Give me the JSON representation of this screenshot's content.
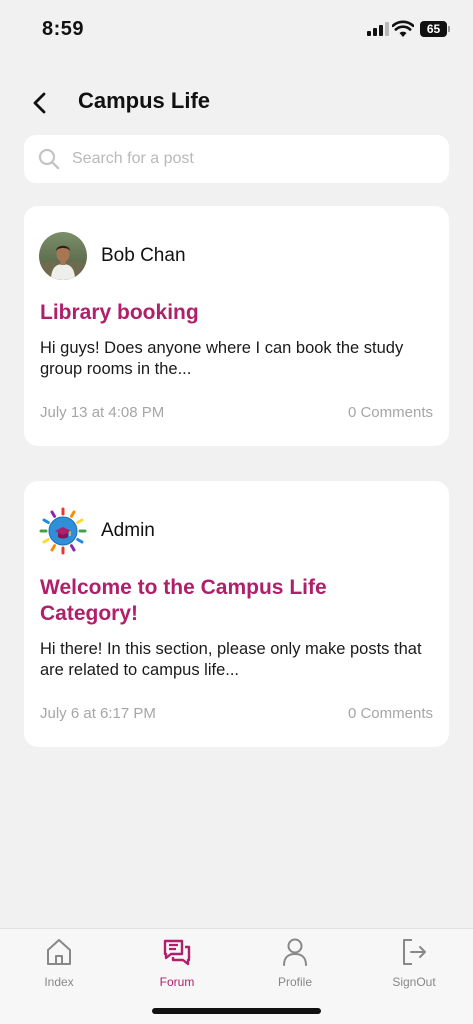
{
  "status_bar": {
    "time": "8:59",
    "battery": "65"
  },
  "header": {
    "title": "Campus Life"
  },
  "search": {
    "placeholder": "Search for a post",
    "value": ""
  },
  "posts": [
    {
      "author": "Bob Chan",
      "avatar_icon": "user-photo-avatar",
      "title": "Library booking",
      "body": "Hi guys!  Does anyone where I can book the study group rooms in the...",
      "date": "July 13 at 4:08 PM",
      "comments": "0 Comments"
    },
    {
      "author": "Admin",
      "avatar_icon": "graduation-cap-logo-avatar",
      "title": "Welcome to the Campus Life Category!",
      "body": "Hi there! In this section, please only make posts that are related to campus life...",
      "date": "July 6 at 6:17 PM",
      "comments": "0 Comments"
    }
  ],
  "tab_bar": {
    "active": "Forum",
    "items": [
      {
        "label": "Index",
        "icon": "home-icon"
      },
      {
        "label": "Forum",
        "icon": "forum-icon"
      },
      {
        "label": "Profile",
        "icon": "person-icon"
      },
      {
        "label": "SignOut",
        "icon": "signout-icon"
      }
    ]
  },
  "colors": {
    "accent": "#b01f6a",
    "background": "#f1f1f1",
    "card": "#ffffff",
    "muted_text": "#a6a6a6"
  }
}
